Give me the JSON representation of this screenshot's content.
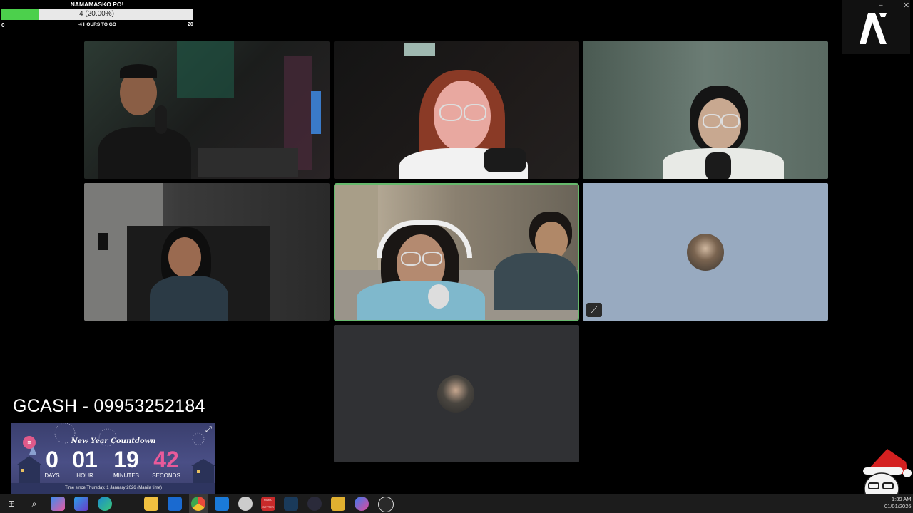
{
  "goal": {
    "title": "NAMAMASKO PO!",
    "progress_text": "4 (20.00%)",
    "progress_fraction": 0.2,
    "min": "0",
    "subtitle": "-4 HOURS TO GO",
    "max": "20"
  },
  "window": {
    "minimize": "–",
    "close": "✕"
  },
  "tiles": [
    {
      "name": "participant-1",
      "muted": false,
      "active": false
    },
    {
      "name": "participant-2",
      "muted": false,
      "active": false
    },
    {
      "name": "participant-3",
      "muted": false,
      "active": false
    },
    {
      "name": "participant-4",
      "muted": false,
      "active": false
    },
    {
      "name": "participant-5",
      "muted": false,
      "active": true
    },
    {
      "name": "participant-6",
      "muted": true,
      "active": false
    },
    {
      "name": "participant-7",
      "muted": false,
      "active": false
    }
  ],
  "gcash": {
    "text": "GCASH - 09953252184"
  },
  "countdown": {
    "title": "New Year Countdown",
    "days": "0",
    "days_label": "DAYS",
    "hours": "01",
    "hours_label": "HOUR",
    "minutes": "19",
    "minutes_label": "MINUTES",
    "seconds": "42",
    "seconds_label": "SECONDS",
    "footer": "Time since Thursday, 1 January 2026 (Manila time)",
    "seconds_color": "#e85a9a"
  },
  "taskbar": {
    "time": "1:39 AM",
    "date": "01/01/2026",
    "icons": [
      "windows-start-icon",
      "search-icon",
      "copilot-icon",
      "microsoft-365-icon",
      "edge-icon",
      "file-explorer-icon",
      "outlook-icon",
      "chrome-icon",
      "microsoft-store-icon",
      "app-icon",
      "video-setter-icon",
      "steam-icon",
      "app-grid-icon",
      "app-icon-2",
      "messenger-icon",
      "obs-icon"
    ],
    "video_setter_label": "VIDEO SETTER"
  },
  "colors": {
    "accent_active": "#66b86c",
    "progress_fill": "#4cd04c",
    "tile_blue": "#98aac0",
    "tile_gray": "#303134"
  }
}
